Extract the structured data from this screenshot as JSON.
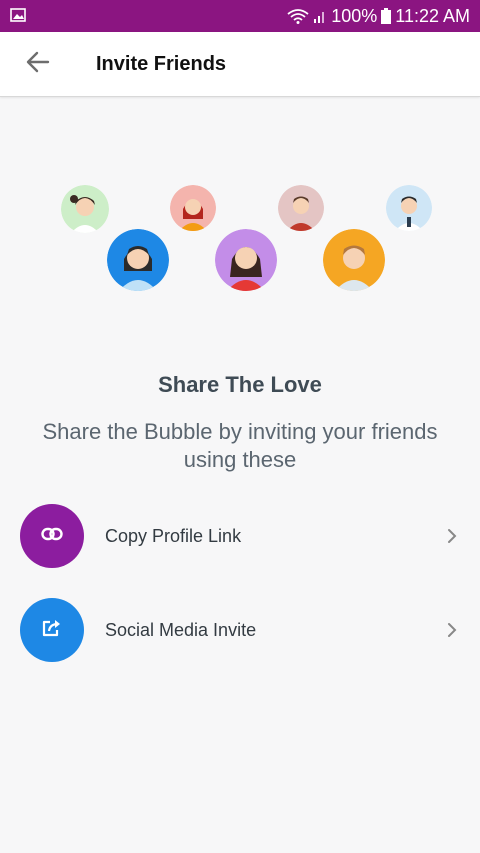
{
  "status_bar": {
    "battery": "100%",
    "time": "11:22 AM",
    "icons": [
      "gallery-icon",
      "wifi-icon",
      "signal-icon",
      "battery-icon"
    ]
  },
  "header": {
    "title": "Invite Friends",
    "back_icon": "arrow-left-icon"
  },
  "illustration": {
    "avatars": [
      {
        "name": "avatar-girl-ponytail",
        "bg": "#cdeec8"
      },
      {
        "name": "avatar-woman-red",
        "bg": "#f4b4ad"
      },
      {
        "name": "avatar-man-red-shirt",
        "bg": "#e4c5c4"
      },
      {
        "name": "avatar-man-tie",
        "bg": "#cfe6f6"
      },
      {
        "name": "avatar-woman-blue",
        "bg": "#1e88e5"
      },
      {
        "name": "avatar-woman-purple",
        "bg": "#c38de8"
      },
      {
        "name": "avatar-man-orange",
        "bg": "#f5a623"
      }
    ]
  },
  "content": {
    "title": "Share The Love",
    "subtitle": "Share the Bubble by inviting your friends using these"
  },
  "options": [
    {
      "label": "Copy Profile Link",
      "icon": "link-icon",
      "color": "#8c1d9f"
    },
    {
      "label": "Social Media Invite",
      "icon": "share-icon",
      "color": "#1e88e5"
    }
  ],
  "colors": {
    "status_bar": "#8b1581",
    "title_text": "#3f4b55"
  }
}
